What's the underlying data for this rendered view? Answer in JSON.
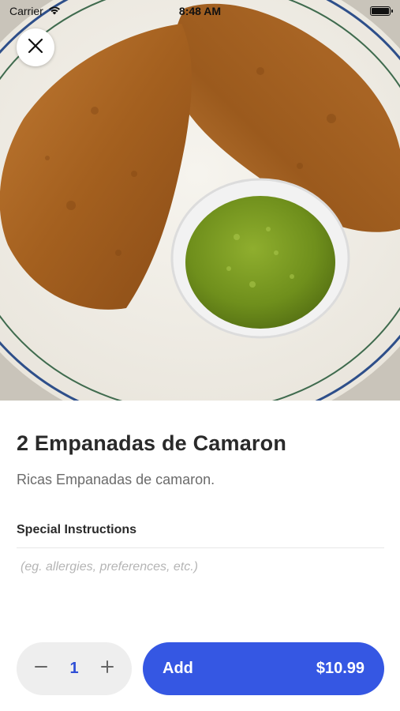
{
  "status_bar": {
    "carrier": "Carrier",
    "time": "8:48 AM"
  },
  "item": {
    "name": "2 Empanadas de Camaron",
    "description": "Ricas Empanadas de camaron."
  },
  "special_instructions": {
    "label": "Special Instructions",
    "placeholder": "(eg. allergies, preferences, etc.)",
    "value": ""
  },
  "quantity": {
    "value": "1",
    "decrement_icon": "minus-icon",
    "increment_icon": "plus-icon"
  },
  "add_button": {
    "label": "Add",
    "price": "$10.99"
  },
  "colors": {
    "accent": "#3557e3",
    "stepper_bg": "#eeeeee",
    "qty_text": "#2f4fd6"
  },
  "icons": {
    "close": "close-icon",
    "wifi": "wifi-icon",
    "battery": "battery-icon"
  }
}
